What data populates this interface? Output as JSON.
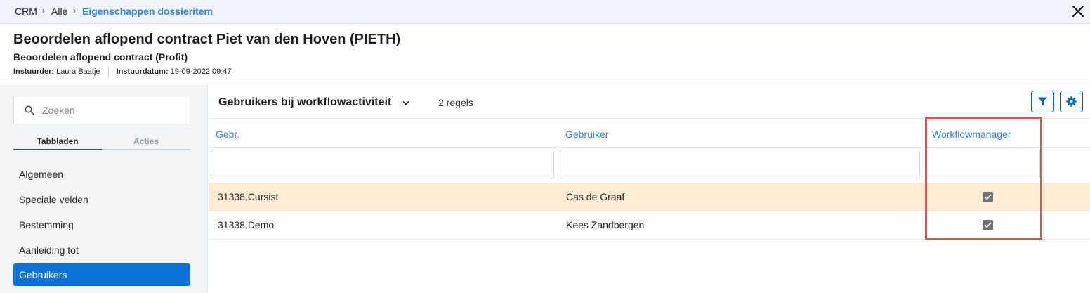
{
  "breadcrumb": {
    "items": [
      "CRM",
      "Alle"
    ],
    "current": "Eigenschappen dossieritem"
  },
  "header": {
    "title": "Beoordelen aflopend contract Piet van den Hoven (PIETH)",
    "subtitle": "Beoordelen aflopend contract (Profit)",
    "submitter_label": "Instuurder:",
    "submitter_value": "Laura Baatje",
    "date_label": "Instuurdatum:",
    "date_value": "19-09-2022 09:47"
  },
  "sidebar": {
    "search_placeholder": "Zoeken",
    "tabs": [
      "Tabbladen",
      "Acties"
    ],
    "items": [
      "Algemeen",
      "Speciale velden",
      "Bestemming",
      "Aanleiding tot",
      "Gebruikers"
    ],
    "active_item": "Gebruikers"
  },
  "main": {
    "view_title": "Gebruikers bij workflowactiviteit",
    "row_count": "2 regels",
    "columns": [
      "Gebr.",
      "Gebruiker",
      "Workflowmanager"
    ],
    "rows": [
      {
        "user_code": "31338.Cursist",
        "user_name": "Cas de Graaf",
        "workflow_manager": true
      },
      {
        "user_code": "31338.Demo",
        "user_name": "Kees Zandbergen",
        "workflow_manager": true
      }
    ]
  },
  "icons": {
    "close": "close-icon",
    "search": "search-icon",
    "filter": "filter-icon",
    "settings": "gear-icon",
    "dropdown": "chevron-down-icon"
  },
  "colors": {
    "accent": "#0a72d6",
    "link": "#2f7fd8",
    "highlight_row": "#fdebd3",
    "annotation": "#e05050"
  }
}
